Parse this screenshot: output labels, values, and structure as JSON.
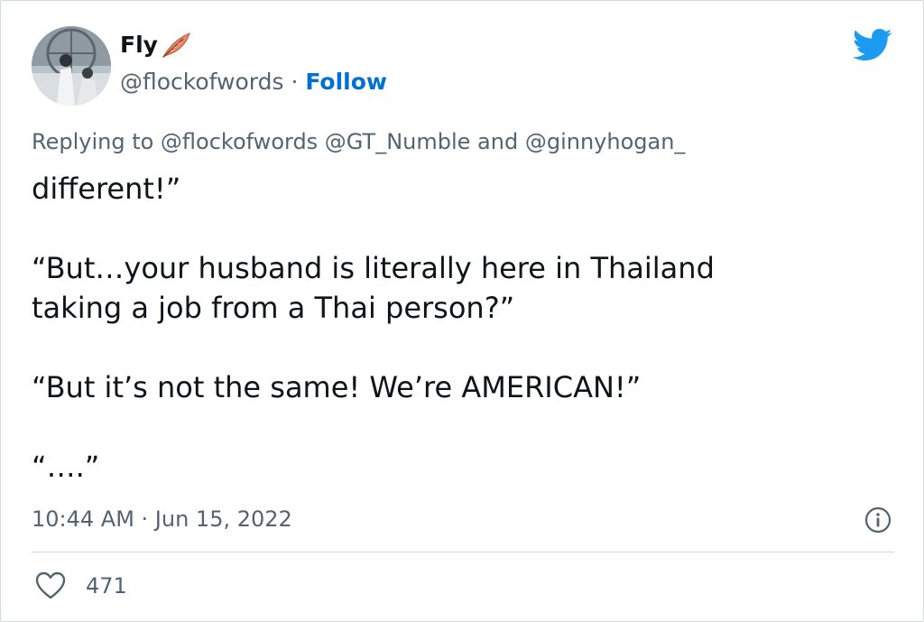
{
  "tweet": {
    "author": {
      "display_name": "Fly",
      "handle": "@flockofwords",
      "separator": " · ",
      "follow_label": "Follow",
      "avatar_icon": "avatar-image",
      "name_emoji_icon": "feather-icon"
    },
    "platform_icon": "twitter-bird-icon",
    "reply_context": "Replying to @flockofwords @GT_Numble and @ginnyhogan_",
    "body": {
      "line1": "different!”",
      "line2": "“But…your husband is literally here in Thailand\ntaking a job from a Thai person?”",
      "line3": "“But it’s not the same! We’re AMERICAN!”",
      "line4": "“….”"
    },
    "timestamp": "10:44 AM · Jun 15, 2022",
    "info_icon": "info-icon",
    "likes": {
      "icon": "heart-icon",
      "count": "471"
    },
    "colors": {
      "text": "#0f1419",
      "muted": "#536471",
      "link": "#006fd6",
      "twitter_blue": "#1d9bf0",
      "divider": "#cfd9de"
    }
  }
}
